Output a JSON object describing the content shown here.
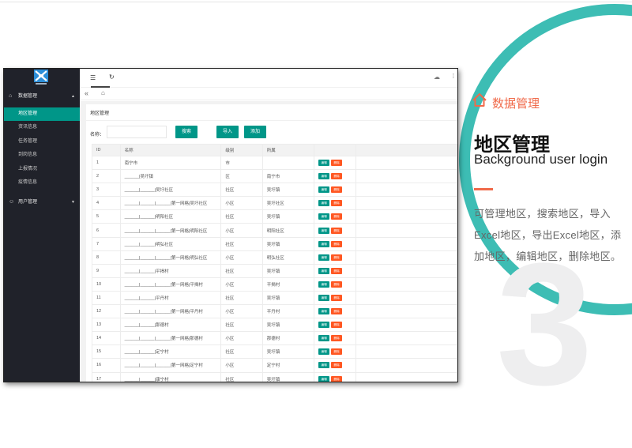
{
  "colors": {
    "accent": "#009688",
    "danger": "#ff5722",
    "highlight": "#f06a4a",
    "arc": "#3dbdb4",
    "sidebar": "#20222a"
  },
  "sidebar": {
    "group1": "数据管理",
    "items": [
      "地区管理",
      "资讯信息",
      "任务管理",
      "到岗信息",
      "上报情况",
      "疫情信息"
    ],
    "group2": "用户管理"
  },
  "topbar": {
    "icons": [
      "menu-fold-icon",
      "refresh-icon",
      "theme-icon",
      "more-icon"
    ]
  },
  "tabs": {
    "icons": [
      "chevron-left-double-icon",
      "home-icon"
    ]
  },
  "panel": {
    "title": "地区管理",
    "search_label": "名称：",
    "search_placeholder": "",
    "search_button": "搜索",
    "import_button": "导入",
    "add_button": "添加"
  },
  "table": {
    "headers": [
      "ID",
      "名称",
      "级别",
      "所属",
      ""
    ],
    "edit_label": "编辑",
    "delete_label": "删除",
    "rows": [
      [
        "1",
        "南宁市",
        "市",
        ""
      ],
      [
        "2",
        "______|吴圩镇",
        "区",
        "南宁市"
      ],
      [
        "3",
        "______|______|吴圩社区",
        "社区",
        "吴圩镇"
      ],
      [
        "4",
        "______|______|______|第一网格|吴圩社区",
        "小区",
        "吴圩社区"
      ],
      [
        "5",
        "______|______|明阳社区",
        "社区",
        "吴圩镇"
      ],
      [
        "6",
        "______|______|______|第一网格|明阳社区",
        "小区",
        "明阳社区"
      ],
      [
        "7",
        "______|______|明弘社区",
        "社区",
        "吴圩镇"
      ],
      [
        "8",
        "______|______|______|第一网格|明弘社区",
        "小区",
        "明弘社区"
      ],
      [
        "9",
        "______|______|平揭村",
        "社区",
        "吴圩镇"
      ],
      [
        "10",
        "______|______|______|第一网格|平揭村",
        "小区",
        "平揭村"
      ],
      [
        "11",
        "______|______|平丹村",
        "社区",
        "吴圩镇"
      ],
      [
        "12",
        "______|______|______|第一网格|平丹村",
        "小区",
        "平丹村"
      ],
      [
        "13",
        "______|______|那德村",
        "社区",
        "吴圩镇"
      ],
      [
        "14",
        "______|______|______|第一网格|那德村",
        "小区",
        "那德村"
      ],
      [
        "15",
        "______|______|定宁村",
        "社区",
        "吴圩镇"
      ],
      [
        "16",
        "______|______|______|第一网格|定宁村",
        "小区",
        "定宁村"
      ],
      [
        "17",
        "______|______|康宁村",
        "社区",
        "吴圩镇"
      ]
    ]
  },
  "feature": {
    "kicker": "数据管理",
    "title": "地区管理",
    "subtitle": "Background user login",
    "description": "可管理地区，搜索地区，导入Excel地区，导出Excel地区，添加地区，编辑地区，删除地区。",
    "number": "3"
  }
}
